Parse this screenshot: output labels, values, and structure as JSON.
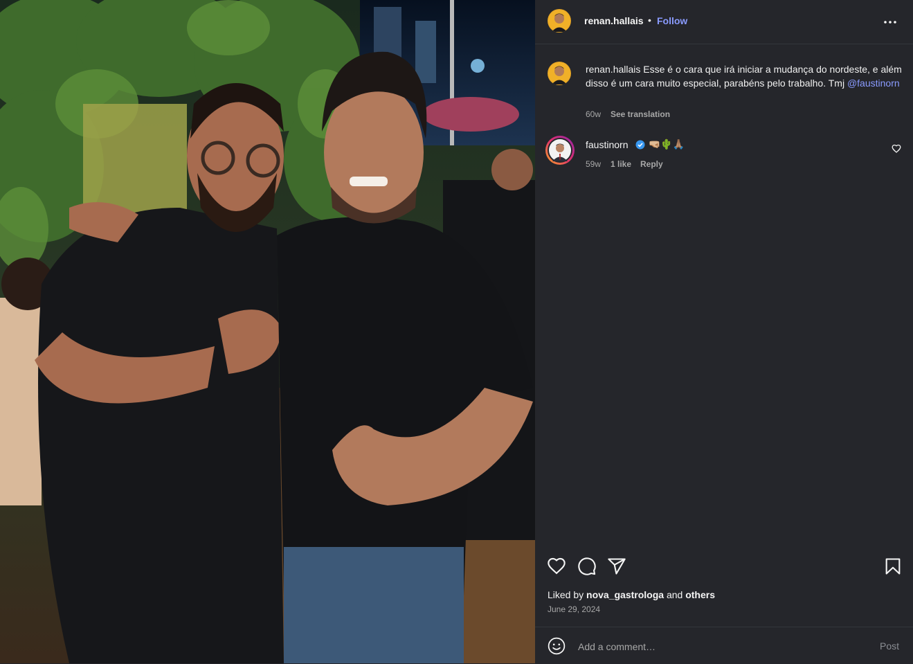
{
  "post": {
    "photo_description_icon": "photo-two-men-icon",
    "author": {
      "username": "renan.hallais",
      "separator": "•",
      "follow_label": "Follow"
    },
    "more_icon": "more-horizontal-icon"
  },
  "caption": {
    "username": "renan.hallais",
    "text": " Esse é o cara que irá iniciar a mudança do nordeste, e além disso é um cara muito especial, parabéns pelo trabalho. Tmj ",
    "mention": "@faustinorn",
    "time": "60w",
    "see_translation": "See translation"
  },
  "comments": [
    {
      "username": "faustinorn",
      "verified_icon": "verified-badge-icon",
      "text": "🤜🏼🌵🙏🏽",
      "time": "59w",
      "likes": "1 like",
      "reply_label": "Reply",
      "like_icon": "heart-icon"
    }
  ],
  "actions": {
    "like_icon": "heart-icon",
    "comment_icon": "comment-icon",
    "share_icon": "send-icon",
    "save_icon": "bookmark-icon"
  },
  "likes": {
    "prefix": "Liked by ",
    "user": "nova_gastrologa",
    "middle": " and ",
    "others": "others"
  },
  "date": "June 29, 2024",
  "comment_box": {
    "emoji_icon": "smile-icon",
    "placeholder": "Add a comment…",
    "post_label": "Post"
  },
  "colors": {
    "background": "#25262b",
    "accent": "#8a9bff",
    "muted": "#a8a8a8"
  }
}
